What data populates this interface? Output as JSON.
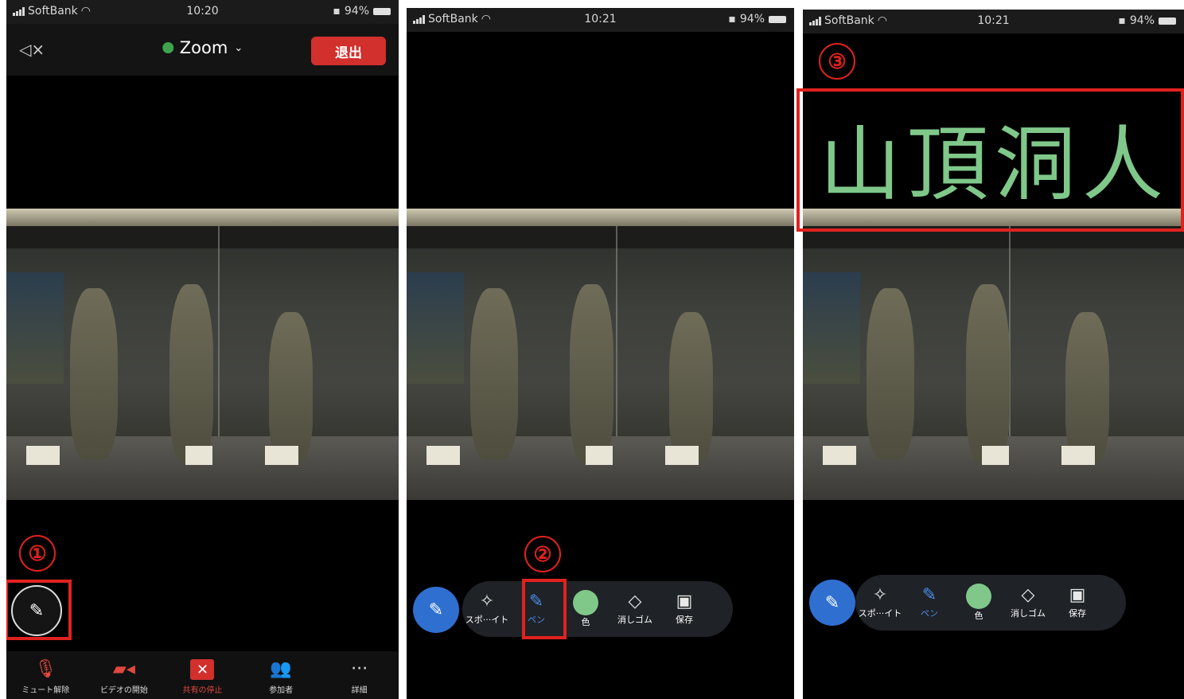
{
  "colors": {
    "accent_red": "#e0221e",
    "zoom_blue": "#2f6fd0",
    "pen_color": "#7fc88a",
    "leave_red": "#d1302d"
  },
  "panel1": {
    "status": {
      "carrier": "SoftBank",
      "time": "10:20",
      "battery": "94%"
    },
    "header": {
      "title": "Zoom",
      "leave": "退出",
      "speaker_icon": "speaker-muted-icon"
    },
    "step": "①",
    "tabs": [
      {
        "label": "ミュート解除",
        "icon": "mic-off-icon"
      },
      {
        "label": "ビデオの開始",
        "icon": "video-off-icon"
      },
      {
        "label": "共有の停止",
        "icon": "stop-share-icon"
      },
      {
        "label": "参加者",
        "icon": "participants-icon"
      },
      {
        "label": "詳細",
        "icon": "more-icon"
      }
    ]
  },
  "panel2": {
    "status": {
      "carrier": "SoftBank",
      "time": "10:21",
      "battery": "94%"
    },
    "step": "②",
    "tools": {
      "spoit": "スポ···イト",
      "pen": "ペン",
      "color": "色",
      "eraser": "消しゴム",
      "save": "保存"
    }
  },
  "panel3": {
    "status": {
      "carrier": "SoftBank",
      "time": "10:21",
      "battery": "94%"
    },
    "step": "③",
    "annotation_text": "山頂洞人",
    "tools": {
      "spoit": "スポ···イト",
      "pen": "ペン",
      "color": "色",
      "eraser": "消しゴム",
      "save": "保存"
    }
  }
}
